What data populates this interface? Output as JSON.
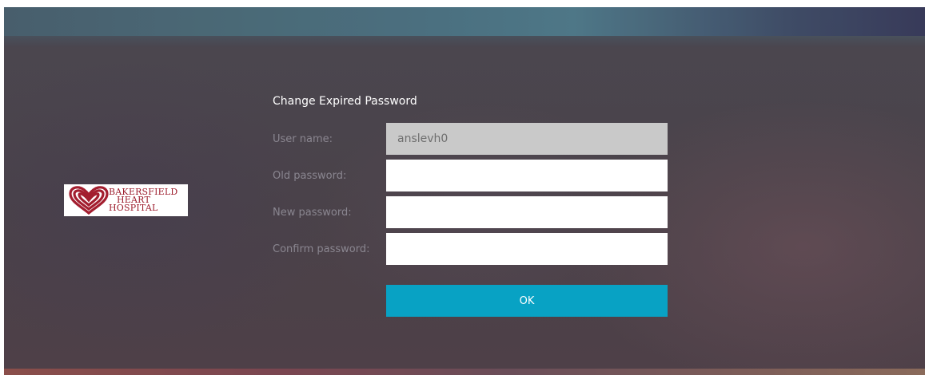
{
  "page": {
    "title": "Change Expired Password"
  },
  "logo": {
    "line1": "BAKERSFIELD",
    "line2": "HEART",
    "line3": "HOSPITAL",
    "icon": "heart-logo-icon",
    "color": "#9d1d2d"
  },
  "form": {
    "username_label": "User name:",
    "username_value": "anslevh0",
    "old_password_label": "Old password:",
    "old_password_value": "",
    "new_password_label": "New password:",
    "new_password_value": "",
    "confirm_password_label": "Confirm password:",
    "confirm_password_value": "",
    "ok_label": "OK"
  },
  "colors": {
    "accent": "#08a2c4",
    "readonly_field": "#c9c9c9",
    "label_text": "#8a8690"
  }
}
